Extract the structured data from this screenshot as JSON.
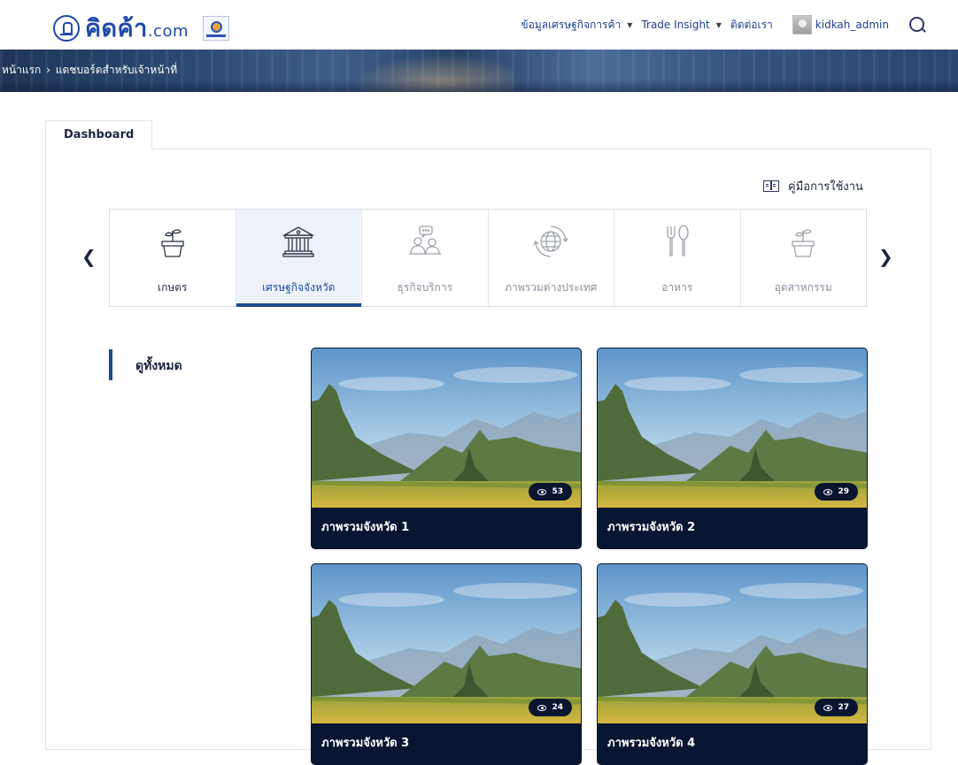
{
  "header": {
    "logo_text": "คิดค้า",
    "logo_suffix": ".com",
    "nav": [
      {
        "label": "ข้อมูลเศรษฐกิจการค้า",
        "has_dropdown": true
      },
      {
        "label": "Trade Insight",
        "has_dropdown": true
      },
      {
        "label": "ติดต่อเรา",
        "has_dropdown": false
      }
    ],
    "username": "kidkah_admin"
  },
  "breadcrumb": {
    "home": "หน้าแรก",
    "separator": "›",
    "current": "แดชบอร์ดสำหรับเจ้าหน้าที่"
  },
  "tab": {
    "label": "Dashboard"
  },
  "guide": {
    "label": "คู่มือการใช้งาน",
    "icon": "book-icon"
  },
  "categories": [
    {
      "label": "เกษตร",
      "icon": "plant-pot-icon",
      "state": "normal"
    },
    {
      "label": "เศรษฐกิจจังหวัด",
      "icon": "government-building-icon",
      "state": "active"
    },
    {
      "label": "ธุรกิจบริการ",
      "icon": "people-chat-icon",
      "state": "dim"
    },
    {
      "label": "ภาพรวมต่างประเทศ",
      "icon": "globe-icon",
      "state": "dim"
    },
    {
      "label": "อาหาร",
      "icon": "fork-spoon-icon",
      "state": "dim"
    },
    {
      "label": "อุตสาหกรรม",
      "icon": "plant-pot-icon",
      "state": "dim"
    }
  ],
  "sidebar": {
    "label": "ดูทั้งหมด"
  },
  "tiles": [
    {
      "title": "ภาพรวมจังหวัด 1",
      "views": "53"
    },
    {
      "title": "ภาพรวมจังหวัด 2",
      "views": "29"
    },
    {
      "title": "ภาพรวมจังหวัด 3",
      "views": "24"
    },
    {
      "title": "ภาพรวมจังหวัด 4",
      "views": "27"
    }
  ],
  "colors": {
    "brand_blue": "#1f4aa8",
    "active_underline": "#1a4d8f",
    "tile_bar": "#081631"
  }
}
